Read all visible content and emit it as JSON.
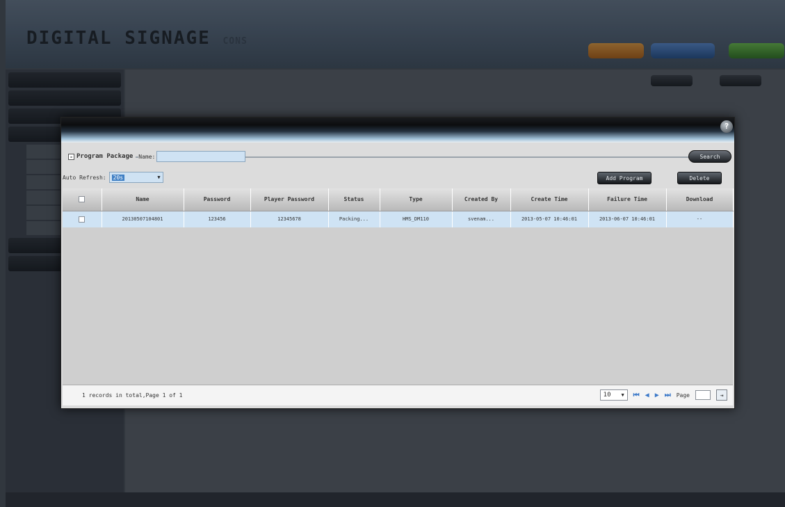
{
  "background": {
    "logo": "DIGITAL SIGNAGE",
    "logo_sub": "CONS",
    "top_info": [
      "",
      "",
      ""
    ],
    "top_buttons": [
      "",
      "",
      ""
    ],
    "crumb": "",
    "sidebar_items": [
      "",
      "",
      "",
      ""
    ]
  },
  "modal": {
    "filter_legend": "Program Package",
    "name_label": "Name:",
    "name_value": "",
    "search_label": "Search",
    "auto_refresh_label": "Auto Refresh:",
    "auto_refresh_value": "20s",
    "add_program_label": "Add Program",
    "delete_label": "Delete",
    "columns": [
      "",
      "Name",
      "Password",
      "Player Password",
      "Status",
      "Type",
      "Created By",
      "Create Time",
      "Failure Time",
      "Download"
    ],
    "rows": [
      {
        "name": "20130507104801",
        "password": "123456",
        "player_password": "12345678",
        "status": "Packing...",
        "type": "HMS_DM110",
        "created_by": "svenam...",
        "create_time": "2013-05-07 10:46:01",
        "failure_time": "2013-06-07 10:46:01",
        "download": "--"
      }
    ],
    "footer_total": "1 records in total,Page 1 of 1",
    "page_size": "10",
    "page_label": "Page"
  },
  "colors": {
    "accent_blue": "#3f7fc4",
    "row_highlight": "#cfe3f4",
    "modal_bg": "#dcdcdc"
  }
}
